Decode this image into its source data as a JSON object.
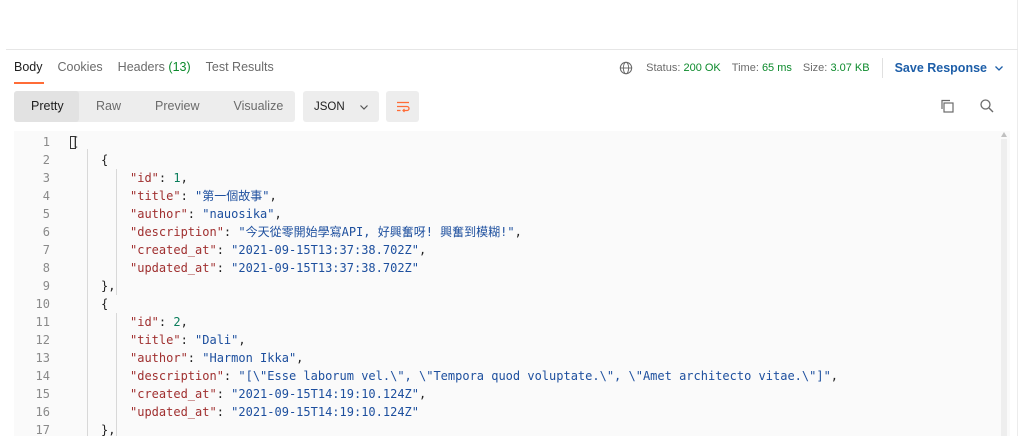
{
  "tabs": [
    {
      "label": "Body",
      "active": true
    },
    {
      "label": "Cookies"
    },
    {
      "label": "Headers",
      "count": "(13)"
    },
    {
      "label": "Test Results"
    }
  ],
  "status": {
    "status_label": "Status:",
    "status_value": "200 OK",
    "time_label": "Time:",
    "time_value": "65 ms",
    "size_label": "Size:",
    "size_value": "3.07 KB",
    "save_response": "Save Response"
  },
  "view_modes": [
    "Pretty",
    "Raw",
    "Preview",
    "Visualize"
  ],
  "active_view": "Pretty",
  "format": "JSON",
  "icons": {
    "globe": "globe-icon",
    "wrap": "wrap-lines-icon",
    "copy": "copy-icon",
    "search": "search-icon",
    "chevron": "chevron-down-icon"
  },
  "colors": {
    "accent": "#ff6c37",
    "status_ok": "#0c8a2c",
    "link": "#1d5ea8",
    "key": "#a03030",
    "string": "#1d4f9e",
    "number": "#0a7d5b"
  },
  "code_lines": [
    {
      "n": "1",
      "ind": 0,
      "parts": [
        [
          "p",
          "["
        ]
      ]
    },
    {
      "n": "2",
      "ind": 1,
      "parts": [
        [
          "p",
          "{"
        ]
      ]
    },
    {
      "n": "3",
      "ind": 2,
      "parts": [
        [
          "k",
          "\"id\""
        ],
        [
          "p",
          ": "
        ],
        [
          "n",
          "1"
        ],
        [
          "p",
          ","
        ]
      ]
    },
    {
      "n": "4",
      "ind": 2,
      "parts": [
        [
          "k",
          "\"title\""
        ],
        [
          "p",
          ": "
        ],
        [
          "s",
          "\"第一個故事\""
        ],
        [
          "p",
          ","
        ]
      ]
    },
    {
      "n": "5",
      "ind": 2,
      "parts": [
        [
          "k",
          "\"author\""
        ],
        [
          "p",
          ": "
        ],
        [
          "s",
          "\"nauosika\""
        ],
        [
          "p",
          ","
        ]
      ]
    },
    {
      "n": "6",
      "ind": 2,
      "parts": [
        [
          "k",
          "\"description\""
        ],
        [
          "p",
          ": "
        ],
        [
          "s",
          "\"今天從零開始學寫API, 好興奮呀! 興奮到模糊!\""
        ],
        [
          "p",
          ","
        ]
      ]
    },
    {
      "n": "7",
      "ind": 2,
      "parts": [
        [
          "k",
          "\"created_at\""
        ],
        [
          "p",
          ": "
        ],
        [
          "s",
          "\"2021-09-15T13:37:38.702Z\""
        ],
        [
          "p",
          ","
        ]
      ]
    },
    {
      "n": "8",
      "ind": 2,
      "parts": [
        [
          "k",
          "\"updated_at\""
        ],
        [
          "p",
          ": "
        ],
        [
          "s",
          "\"2021-09-15T13:37:38.702Z\""
        ]
      ]
    },
    {
      "n": "9",
      "ind": 1,
      "parts": [
        [
          "p",
          "},"
        ]
      ]
    },
    {
      "n": "10",
      "ind": 1,
      "parts": [
        [
          "p",
          "{"
        ]
      ]
    },
    {
      "n": "11",
      "ind": 2,
      "parts": [
        [
          "k",
          "\"id\""
        ],
        [
          "p",
          ": "
        ],
        [
          "n",
          "2"
        ],
        [
          "p",
          ","
        ]
      ]
    },
    {
      "n": "12",
      "ind": 2,
      "parts": [
        [
          "k",
          "\"title\""
        ],
        [
          "p",
          ": "
        ],
        [
          "s",
          "\"Dali\""
        ],
        [
          "p",
          ","
        ]
      ]
    },
    {
      "n": "13",
      "ind": 2,
      "parts": [
        [
          "k",
          "\"author\""
        ],
        [
          "p",
          ": "
        ],
        [
          "s",
          "\"Harmon Ikka\""
        ],
        [
          "p",
          ","
        ]
      ]
    },
    {
      "n": "14",
      "ind": 2,
      "parts": [
        [
          "k",
          "\"description\""
        ],
        [
          "p",
          ": "
        ],
        [
          "s",
          "\"[\\\"Esse laborum vel.\\\", \\\"Tempora quod voluptate.\\\", \\\"Amet architecto vitae.\\\"]\""
        ],
        [
          "p",
          ","
        ]
      ]
    },
    {
      "n": "15",
      "ind": 2,
      "parts": [
        [
          "k",
          "\"created_at\""
        ],
        [
          "p",
          ": "
        ],
        [
          "s",
          "\"2021-09-15T14:19:10.124Z\""
        ],
        [
          "p",
          ","
        ]
      ]
    },
    {
      "n": "16",
      "ind": 2,
      "parts": [
        [
          "k",
          "\"updated_at\""
        ],
        [
          "p",
          ": "
        ],
        [
          "s",
          "\"2021-09-15T14:19:10.124Z\""
        ]
      ]
    },
    {
      "n": "17",
      "ind": 1,
      "parts": [
        [
          "p",
          "},"
        ]
      ]
    }
  ]
}
